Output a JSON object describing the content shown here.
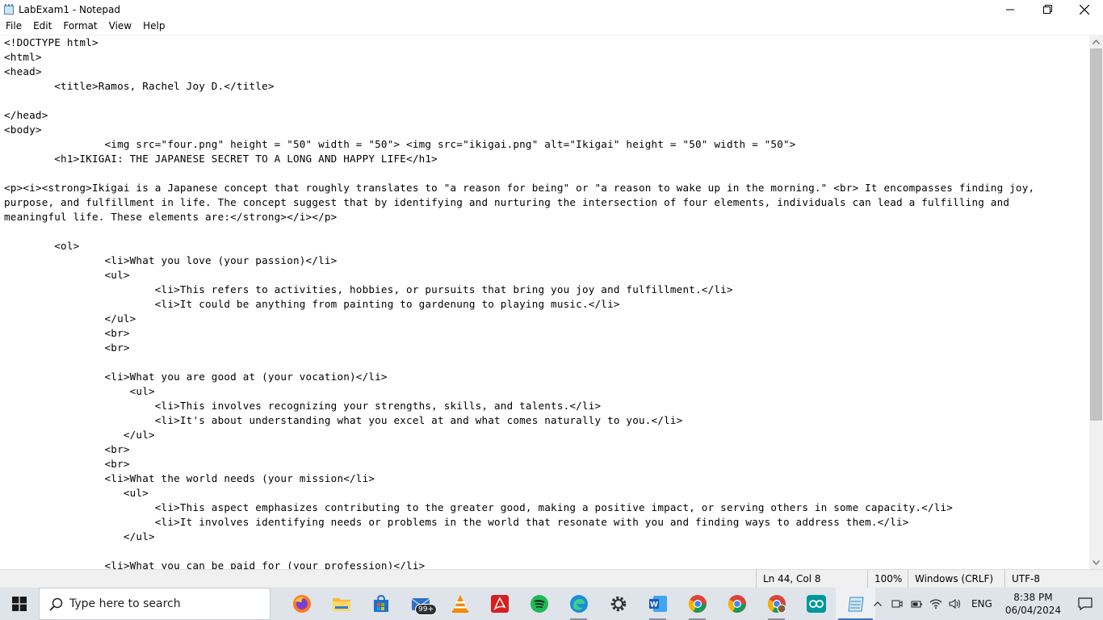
{
  "window": {
    "title": "LabExam1 - Notepad",
    "icon": "notepad-icon"
  },
  "menu": {
    "items": [
      "File",
      "Edit",
      "Format",
      "View",
      "Help"
    ]
  },
  "editor": {
    "lines": [
      "<!DOCTYPE html>",
      "<html>",
      "<head>",
      "        <title>Ramos, Rachel Joy D.</title>",
      "",
      "</head>",
      "<body>",
      "                <img src=\"four.png\" height = \"50\" width = \"50\"> <img src=\"ikigai.png\" alt=\"Ikigai\" height = \"50\" width = \"50\">",
      "        <h1>IKIGAI: THE JAPANESE SECRET TO A LONG AND HAPPY LIFE</h1>",
      "",
      "<p><i><strong>Ikigai is a Japanese concept that roughly translates to \"a reason for being\" or \"a reason to wake up in the morning.\" <br> It encompasses finding joy,",
      "purpose, and fulfillment in life. The concept suggest that by identifying and nurturing the intersection of four elements, individuals can lead a fulfilling and",
      "meaningful life. These elements are:</strong></i></p>",
      "",
      "        <ol>",
      "                <li>What you love (your passion)</li>",
      "                <ul>",
      "                        <li>This refers to activities, hobbies, or pursuits that bring you joy and fulfillment.</li>",
      "                        <li>It could be anything from painting to gardenung to playing music.</li>",
      "                </ul>",
      "                <br>",
      "                <br>",
      "",
      "                <li>What you are good at (your vocation)</li>",
      "                    <ul>",
      "                        <li>This involves recognizing your strengths, skills, and talents.</li>",
      "                        <li>It's about understanding what you excel at and what comes naturally to you.</li>",
      "                   </ul>",
      "                <br>",
      "                <br>",
      "                <li>What the world needs (your mission</li>",
      "                   <ul>",
      "                        <li>This aspect emphasizes contributing to the greater good, making a positive impact, or serving others in some capacity.</li>",
      "                        <li>It involves identifying needs or problems in the world that resonate with you and finding ways to address them.</li>",
      "                   </ul>",
      "",
      "                <li>What you can be paid for (your profession)</li>"
    ]
  },
  "status": {
    "position": "Ln 44, Col 8",
    "zoom": "100%",
    "line_ending": "Windows (CRLF)",
    "encoding": "UTF-8"
  },
  "taskbar": {
    "search_placeholder": "Type here to search",
    "mail_badge": "99+",
    "apps": [
      "firefox-icon",
      "file-explorer-icon",
      "microsoft-store-icon",
      "mail-icon",
      "vlc-icon",
      "acrobat-icon",
      "spotify-icon",
      "edge-icon",
      "settings-icon",
      "word-icon",
      "chrome-icon",
      "chrome-icon",
      "chrome-profile-icon",
      "arduino-icon",
      "notepad-icon"
    ],
    "language": "ENG",
    "time": "8:38 PM",
    "date": "06/04/2024"
  }
}
